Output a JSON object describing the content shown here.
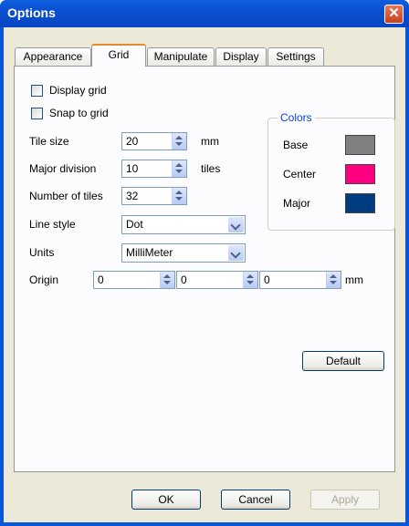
{
  "window": {
    "title": "Options",
    "close_glyph": "✕"
  },
  "tabs": [
    {
      "label": "Appearance",
      "active": false
    },
    {
      "label": "Grid",
      "active": true
    },
    {
      "label": "Manipulate",
      "active": false
    },
    {
      "label": "Display",
      "active": false
    },
    {
      "label": "Settings",
      "active": false
    }
  ],
  "grid": {
    "display_grid": {
      "label": "Display grid",
      "checked": false
    },
    "snap_to_grid": {
      "label": "Snap to grid",
      "checked": false
    },
    "tile_size": {
      "label": "Tile size",
      "value": "20",
      "unit": "mm"
    },
    "major_division": {
      "label": "Major division",
      "value": "10",
      "unit": "tiles"
    },
    "number_of_tiles": {
      "label": "Number of tiles",
      "value": "32"
    },
    "line_style": {
      "label": "Line style",
      "value": "Dot"
    },
    "units": {
      "label": "Units",
      "value": "MilliMeter"
    },
    "origin": {
      "label": "Origin",
      "x": "0",
      "y": "0",
      "z": "0",
      "unit": "mm"
    }
  },
  "colors": {
    "title": "Colors",
    "base": {
      "label": "Base",
      "color": "#808080"
    },
    "center": {
      "label": "Center",
      "color": "#ff0080"
    },
    "major": {
      "label": "Major",
      "color": "#003c80"
    }
  },
  "buttons": {
    "default": "Default",
    "ok": "OK",
    "cancel": "Cancel",
    "apply": "Apply"
  },
  "icons": {
    "spin": "spin-up-down-icon",
    "combo": "dropdown-arrow-icon",
    "close": "close-icon"
  }
}
